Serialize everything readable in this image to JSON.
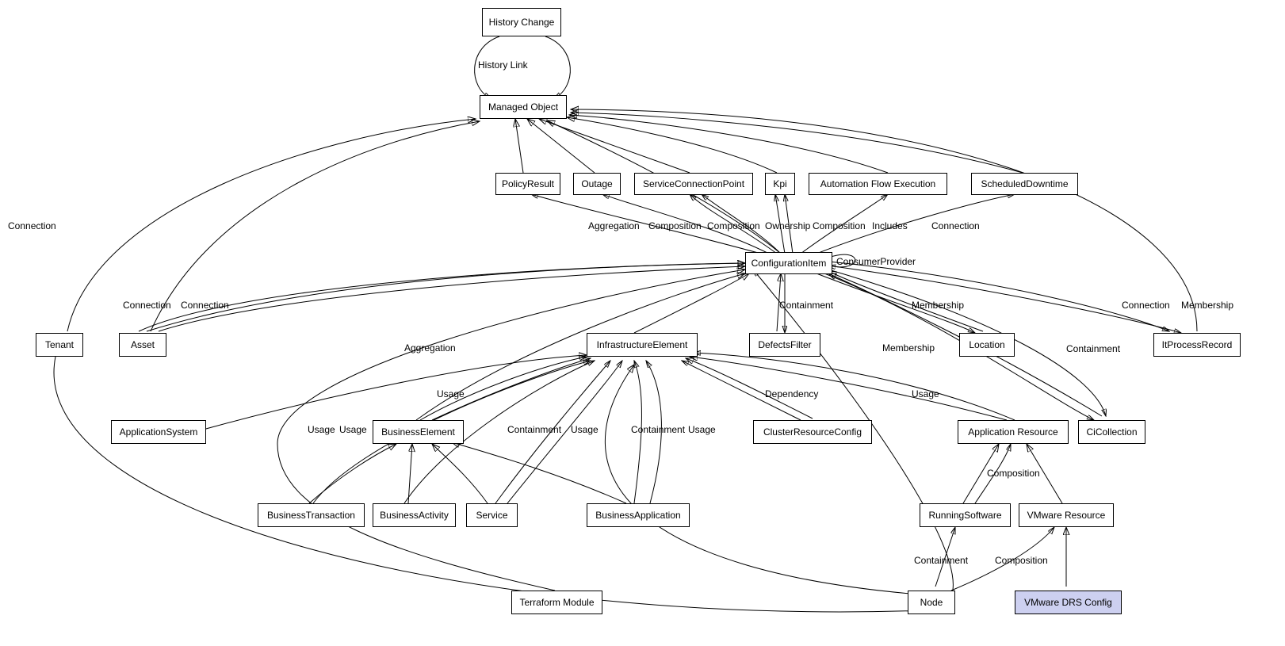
{
  "nodes": {
    "history_change": "History Change",
    "managed_object": "Managed Object",
    "policy_result": "PolicyResult",
    "outage": "Outage",
    "service_connection_point": "ServiceConnectionPoint",
    "kpi": "Kpi",
    "automation_flow_execution": "Automation Flow Execution",
    "scheduled_downtime": "ScheduledDowntime",
    "configuration_item": "ConfigurationItem",
    "tenant": "Tenant",
    "asset": "Asset",
    "infrastructure_element": "InfrastructureElement",
    "defects_filter": "DefectsFilter",
    "location": "Location",
    "it_process_record": "ItProcessRecord",
    "application_system": "ApplicationSystem",
    "business_element": "BusinessElement",
    "cluster_resource_config": "ClusterResourceConfig",
    "application_resource": "Application Resource",
    "ci_collection": "CiCollection",
    "business_transaction": "BusinessTransaction",
    "business_activity": "BusinessActivity",
    "service": "Service",
    "business_application": "BusinessApplication",
    "running_software": "RunningSoftware",
    "vmware_resource": "VMware Resource",
    "node": "Node",
    "terraform_module": "Terraform Module",
    "vmware_drs_config": "VMware DRS Config"
  },
  "edge_labels": {
    "history_link": "History Link",
    "connection_tenant": "Connection",
    "connection_asset1": "Connection",
    "connection_asset2": "Connection",
    "aggregation_pr": "Aggregation",
    "composition_outage": "Composition",
    "composition_scp": "Composition",
    "ownership_kpi": "Ownership",
    "composition_kpi": "Composition",
    "includes_afe": "Includes",
    "connection_sd": "Connection",
    "consumer_provider": "ConsumerProvider",
    "containment_df": "Containment",
    "membership_loc": "Membership",
    "membership_cic": "Membership",
    "connection_ipr": "Connection",
    "membership_ipr": "Membership",
    "containment_cic": "Containment",
    "aggregation_ie": "Aggregation",
    "usage_be": "Usage",
    "usage_bt": "Usage",
    "usage_ba": "Usage",
    "containment_svc": "Containment",
    "usage_svc": "Usage",
    "containment_bapp": "Containment",
    "usage_bapp": "Usage",
    "dependency_crc": "Dependency",
    "usage_ar": "Usage",
    "composition_rs": "Composition",
    "containment_node": "Containment",
    "composition_vr": "Composition"
  }
}
